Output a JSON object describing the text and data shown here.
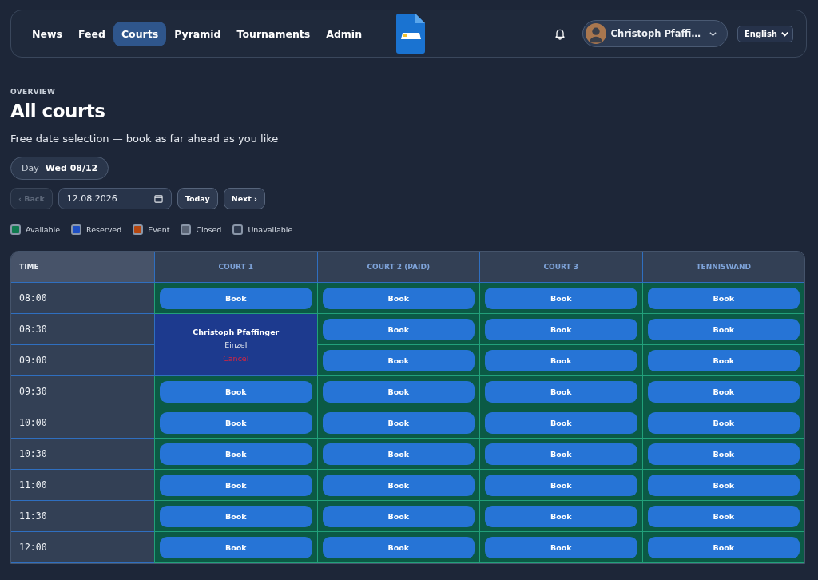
{
  "nav": {
    "items": [
      {
        "label": "News",
        "selected": false
      },
      {
        "label": "Feed",
        "selected": false
      },
      {
        "label": "Courts",
        "selected": true
      },
      {
        "label": "Pyramid",
        "selected": false
      },
      {
        "label": "Tournaments",
        "selected": false
      },
      {
        "label": "Admin",
        "selected": false
      }
    ],
    "user": {
      "name": "Christoph Pfaffi…"
    },
    "language": {
      "value": "English"
    }
  },
  "header": {
    "eyebrow": "OVERVIEW",
    "title": "All courts",
    "subtitle": "Free date selection — book as far ahead as you like"
  },
  "day_chip": {
    "label": "Day",
    "value": "Wed 08/12"
  },
  "date_controls": {
    "back": {
      "label": "‹ Back",
      "disabled": true
    },
    "date": "12.08.2026",
    "today": "Today",
    "next": "Next ›"
  },
  "legend": [
    {
      "label": "Available",
      "color": "#0f7a4f"
    },
    {
      "label": "Reserved",
      "color": "#1e4fc4"
    },
    {
      "label": "Event",
      "color": "#b5460f"
    },
    {
      "label": "Closed",
      "color": "#5a6475"
    },
    {
      "label": "Unavailable",
      "color": "#2f3a4e"
    }
  ],
  "table": {
    "columns": [
      "TIME",
      "COURT 1",
      "COURT 2 (PAID)",
      "COURT 3",
      "TENNISWAND"
    ],
    "rows": [
      {
        "cells": [
          {
            "kind": "time",
            "text": "08:00"
          },
          {
            "kind": "book",
            "label": "Book"
          },
          {
            "kind": "book",
            "label": "Book"
          },
          {
            "kind": "book",
            "label": "Book"
          },
          {
            "kind": "book",
            "label": "Book"
          }
        ]
      },
      {
        "cells": [
          {
            "kind": "time",
            "text": "08:30"
          },
          {
            "kind": "reservation",
            "rowspan": 2,
            "name": "Christoph Pfaffinger",
            "type": "Einzel",
            "action": "Cancel"
          },
          {
            "kind": "book",
            "label": "Book"
          },
          {
            "kind": "book",
            "label": "Book"
          },
          {
            "kind": "book",
            "label": "Book"
          }
        ]
      },
      {
        "cells": [
          {
            "kind": "time",
            "text": "09:00"
          },
          {
            "kind": "book",
            "label": "Book"
          },
          {
            "kind": "book",
            "label": "Book"
          },
          {
            "kind": "book",
            "label": "Book"
          }
        ]
      },
      {
        "cells": [
          {
            "kind": "time",
            "text": "09:30"
          },
          {
            "kind": "book",
            "label": "Book"
          },
          {
            "kind": "book",
            "label": "Book"
          },
          {
            "kind": "book",
            "label": "Book"
          },
          {
            "kind": "book",
            "label": "Book"
          }
        ]
      },
      {
        "cells": [
          {
            "kind": "time",
            "text": "10:00"
          },
          {
            "kind": "book",
            "label": "Book"
          },
          {
            "kind": "book",
            "label": "Book"
          },
          {
            "kind": "book",
            "label": "Book"
          },
          {
            "kind": "book",
            "label": "Book"
          }
        ]
      },
      {
        "cells": [
          {
            "kind": "time",
            "text": "10:30"
          },
          {
            "kind": "book",
            "label": "Book"
          },
          {
            "kind": "book",
            "label": "Book"
          },
          {
            "kind": "book",
            "label": "Book"
          },
          {
            "kind": "book",
            "label": "Book"
          }
        ]
      },
      {
        "cells": [
          {
            "kind": "time",
            "text": "11:00"
          },
          {
            "kind": "book",
            "label": "Book"
          },
          {
            "kind": "book",
            "label": "Book"
          },
          {
            "kind": "book",
            "label": "Book"
          },
          {
            "kind": "book",
            "label": "Book"
          }
        ]
      },
      {
        "cells": [
          {
            "kind": "time",
            "text": "11:30"
          },
          {
            "kind": "book",
            "label": "Book"
          },
          {
            "kind": "book",
            "label": "Book"
          },
          {
            "kind": "book",
            "label": "Book"
          },
          {
            "kind": "book",
            "label": "Book"
          }
        ]
      },
      {
        "cells": [
          {
            "kind": "time",
            "text": "12:00"
          },
          {
            "kind": "book",
            "label": "Book"
          },
          {
            "kind": "book",
            "label": "Book"
          },
          {
            "kind": "book",
            "label": "Book"
          },
          {
            "kind": "book",
            "label": "Book"
          }
        ]
      }
    ]
  }
}
